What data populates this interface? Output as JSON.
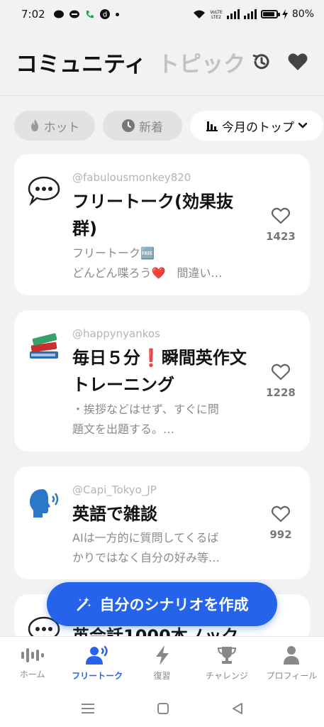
{
  "status_bar": {
    "time": "7:02",
    "network_label": "Vo) LTE2",
    "battery": "80%"
  },
  "header": {
    "tabs": [
      {
        "label": "コミュニティ",
        "active": true
      },
      {
        "label": "トピック",
        "active": false
      }
    ],
    "icons": [
      "history-icon",
      "heart-icon"
    ]
  },
  "filters": {
    "hot": "ホット",
    "new": "新着",
    "top": "今月のトップ"
  },
  "cards": [
    {
      "emoji": "speech-bubble-icon",
      "handle": "@fabulousmonkey820",
      "title": "フリートーク(効果抜群)",
      "desc_line1": "フリートーク🆓",
      "desc_line2": "どんどん喋ろう❤️　間違い…",
      "likes": "1423"
    },
    {
      "emoji": "books-icon",
      "handle": "@happynyankos",
      "title": "毎日５分❗瞬間英作文トレーニング",
      "desc_line1": "・挨拶などはせず、すぐに問",
      "desc_line2": "題文を出題する。…",
      "likes": "1228"
    },
    {
      "emoji": "speaking-head-icon",
      "handle": "@Capi_Tokyo_JP",
      "title": "英語で雑談",
      "desc_line1": "AIは一方的に質問してくるば",
      "desc_line2": "かりではなく自分の好み等…",
      "likes": "992"
    },
    {
      "emoji": "speech-bubble-icon",
      "handle": "",
      "title": "英会話1000本ノック",
      "likes": ""
    }
  ],
  "fab": {
    "label": "自分のシナリオを作成"
  },
  "bottom_nav": {
    "items": [
      {
        "label": "ホーム",
        "icon": "waveform-icon"
      },
      {
        "label": "フリートーク",
        "icon": "speaking-person-icon",
        "active": true
      },
      {
        "label": "復習",
        "icon": "lightning-icon"
      },
      {
        "label": "チャレンジ",
        "icon": "trophy-icon"
      },
      {
        "label": "プロフィール",
        "icon": "person-icon"
      }
    ]
  },
  "colors": {
    "accent": "#2563eb",
    "background": "#f2f2f2",
    "card": "#ffffff",
    "chip_inactive": "#e2e2e2"
  }
}
